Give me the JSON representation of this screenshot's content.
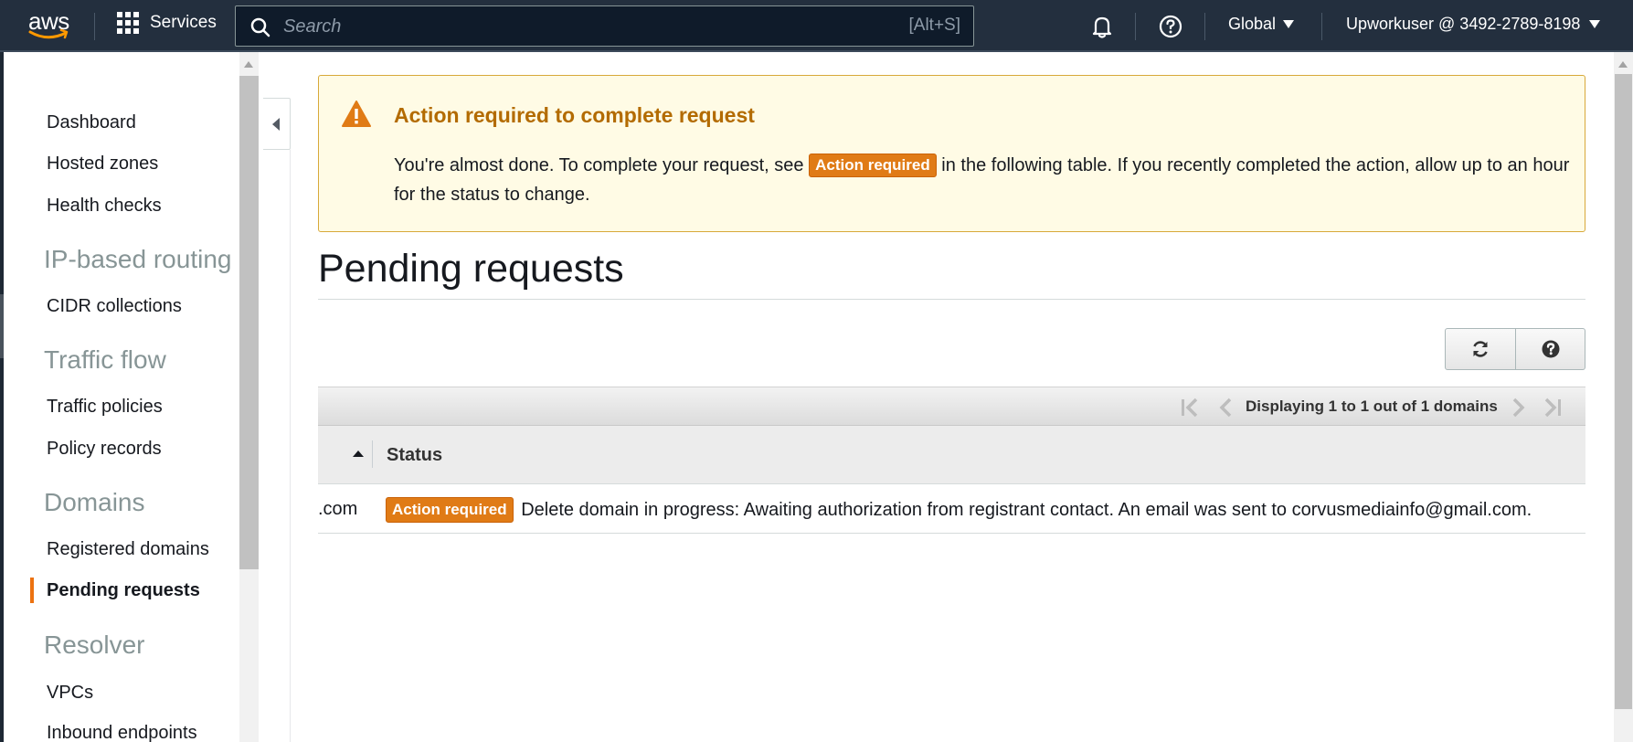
{
  "topnav": {
    "logo_text": "aws",
    "services_label": "Services",
    "search_placeholder": "Search",
    "search_shortcut": "[Alt+S]",
    "region_label": "Global",
    "account_label": "Upworkuser @ 3492-2789-8198",
    "icons": [
      "grid-icon",
      "search-icon",
      "bell-icon",
      "help-icon",
      "caret-down-icon"
    ]
  },
  "sidebar": {
    "items": [
      {
        "label": "Dashboard"
      },
      {
        "label": "Hosted zones"
      },
      {
        "label": "Health checks"
      }
    ],
    "sections": [
      {
        "title": "IP-based routing",
        "items": [
          {
            "label": "CIDR collections"
          }
        ]
      },
      {
        "title": "Traffic flow",
        "items": [
          {
            "label": "Traffic policies"
          },
          {
            "label": "Policy records"
          }
        ]
      },
      {
        "title": "Domains",
        "items": [
          {
            "label": "Registered domains"
          },
          {
            "label": "Pending requests",
            "active": true
          }
        ]
      },
      {
        "title": "Resolver",
        "items": [
          {
            "label": "VPCs"
          },
          {
            "label": "Inbound endpoints"
          }
        ]
      }
    ]
  },
  "alert": {
    "title": "Action required to complete request",
    "body_before": "You're almost done. To complete your request, see",
    "badge": "Action required",
    "body_after": "in the following table. If you recently completed the action, allow up to an hour for the status to change."
  },
  "page": {
    "title": "Pending requests"
  },
  "pager": {
    "text": "Displaying 1 to 1 out of 1 domains"
  },
  "table": {
    "columns": [
      "Status"
    ],
    "rows": [
      {
        "domain": ".com",
        "badge": "Action required",
        "status_text": "Delete domain in progress: Awaiting authorization from registrant contact. An email was sent to corvusmediainfo@gmail.com."
      }
    ]
  },
  "colors": {
    "nav_bg": "#232f3e",
    "accent": "#ec7211",
    "warning_title": "#b36b00",
    "alert_bg": "#fffbe5",
    "badge_bg": "#e07b16"
  }
}
